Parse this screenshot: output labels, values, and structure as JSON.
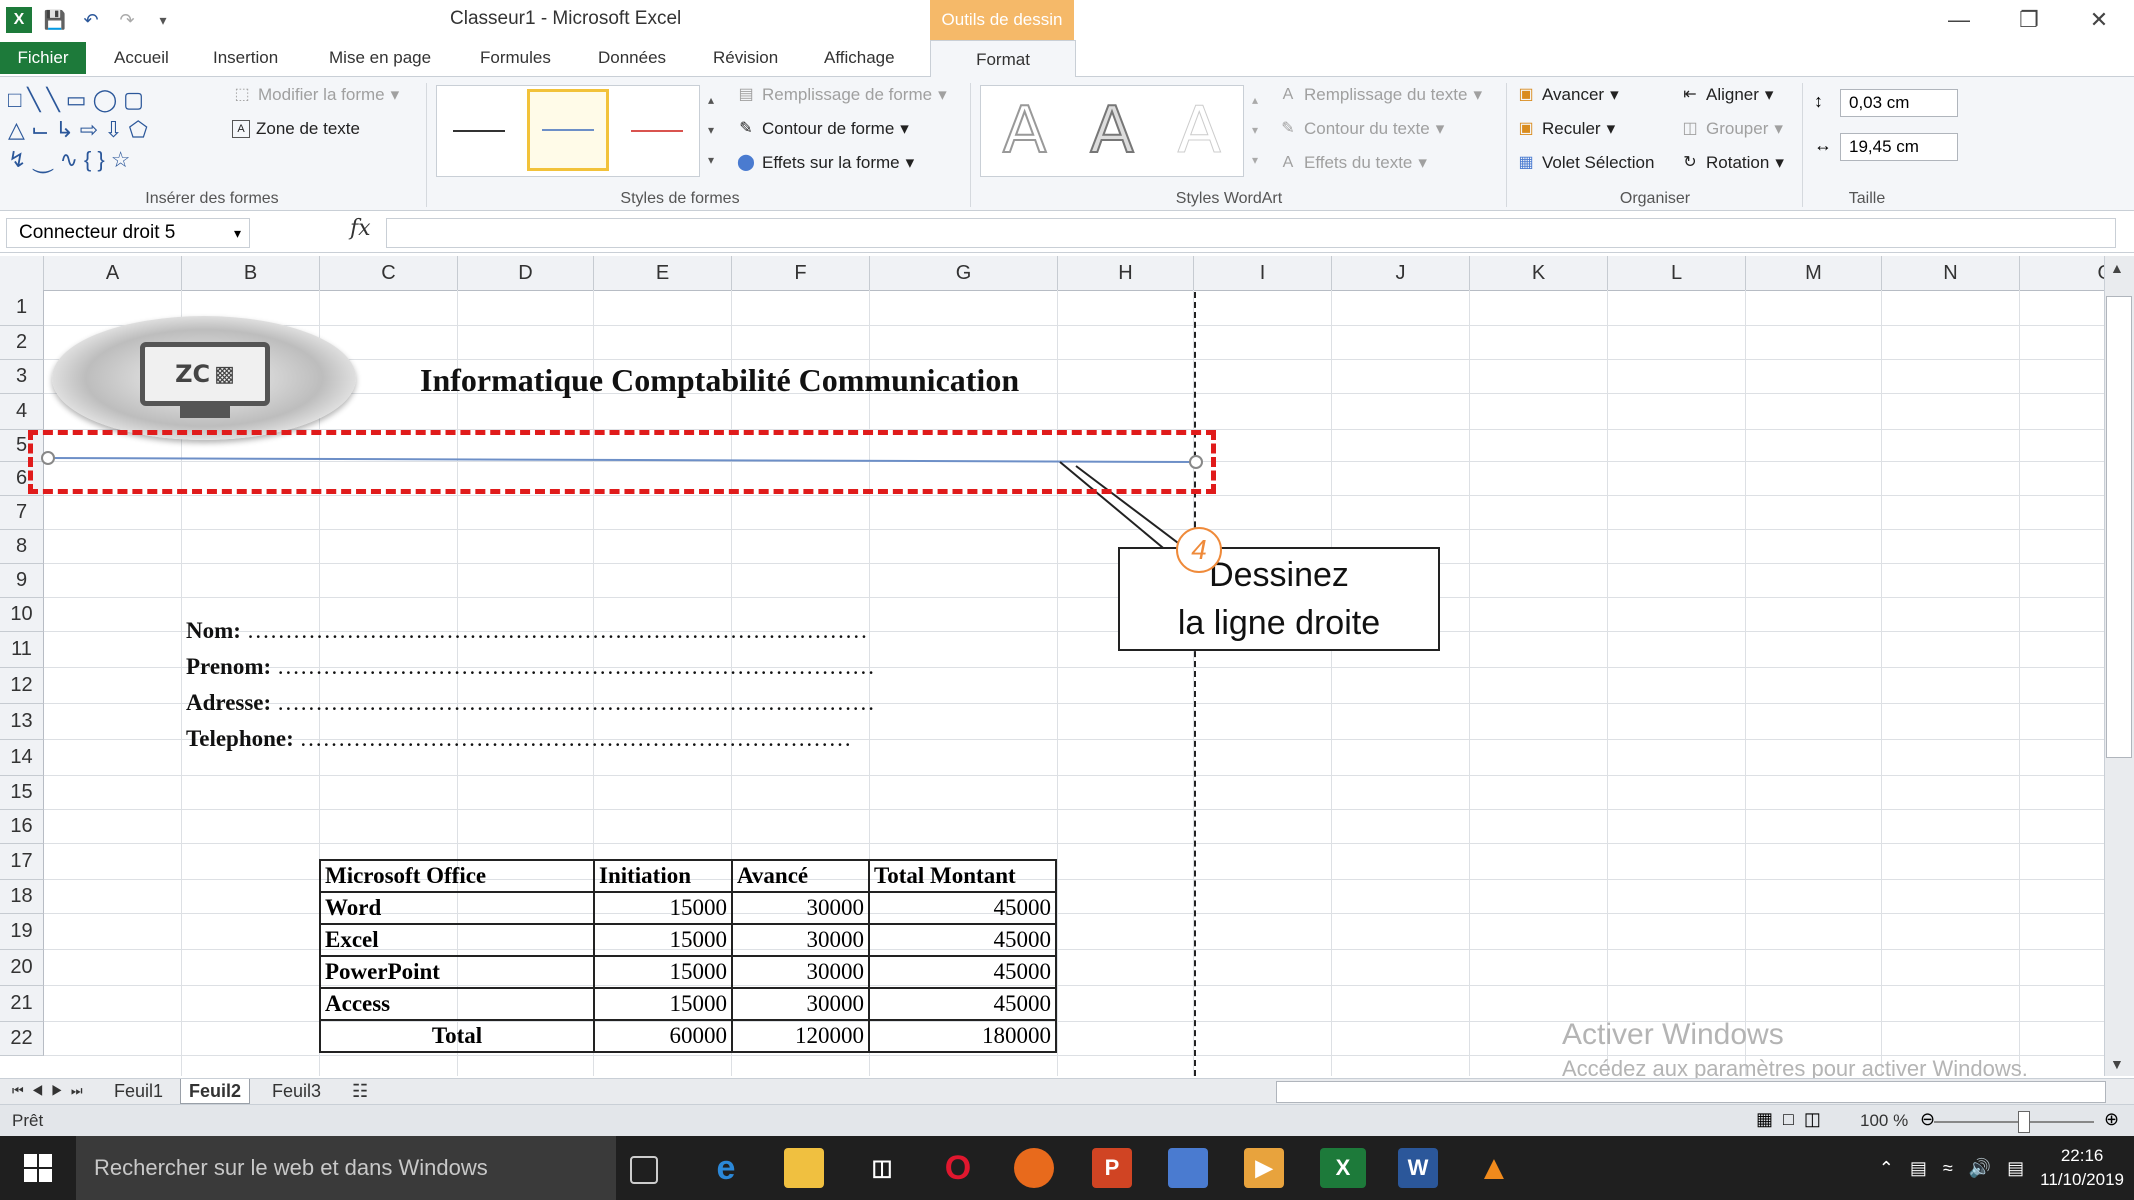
{
  "window": {
    "title": "Classeur1 - Microsoft Excel",
    "context_tab_group": "Outils de dessin"
  },
  "tabs": {
    "file": "Fichier",
    "home": "Accueil",
    "insert": "Insertion",
    "layout": "Mise en page",
    "formulas": "Formules",
    "data": "Données",
    "review": "Révision",
    "view": "Affichage",
    "format": "Format"
  },
  "ribbon": {
    "insert_shapes": {
      "label": "Insérer des formes",
      "edit_shape": "Modifier la forme",
      "text_box": "Zone de texte"
    },
    "shape_styles": {
      "label": "Styles de formes",
      "fill": "Remplissage de forme",
      "outline": "Contour de forme",
      "effects": "Effets sur la forme"
    },
    "wordart": {
      "label": "Styles WordArt",
      "text_fill": "Remplissage du texte",
      "text_outline": "Contour du texte",
      "text_effects": "Effets du texte",
      "sample": "A"
    },
    "arrange": {
      "label": "Organiser",
      "bring_forward": "Avancer",
      "send_backward": "Reculer",
      "selection_pane": "Volet Sélection",
      "align": "Aligner",
      "group": "Grouper",
      "rotate": "Rotation"
    },
    "size": {
      "label": "Taille",
      "height": "0,03 cm",
      "width": "19,45 cm"
    }
  },
  "formula_bar": {
    "name_box": "Connecteur droit 5",
    "fx": "fx",
    "value": ""
  },
  "columns": [
    "A",
    "B",
    "C",
    "D",
    "E",
    "F",
    "G",
    "H",
    "I",
    "J",
    "K",
    "L",
    "M",
    "N",
    "O"
  ],
  "rows": [
    "1",
    "2",
    "3",
    "4",
    "5",
    "6",
    "7",
    "8",
    "9",
    "10",
    "11",
    "12",
    "13",
    "14",
    "15",
    "16",
    "17",
    "18",
    "19",
    "20",
    "21",
    "22"
  ],
  "sheet": {
    "title": "Informatique Comptabilité Communication",
    "logo_text": "ZC",
    "form_fields": [
      {
        "label": "Nom:",
        "dots": "………………………………………………………………………"
      },
      {
        "label": "Prenom:",
        "dots": "……………………………………………………………………"
      },
      {
        "label": "Adresse:",
        "dots": "……………………………………………………………………"
      },
      {
        "label": "Telephone:",
        "dots": "………………………………………………………………"
      }
    ],
    "table": {
      "headers": [
        "Microsoft Office",
        "Initiation",
        "Avancé",
        "Total Montant"
      ],
      "rows": [
        [
          "Word",
          "15000",
          "30000",
          "45000"
        ],
        [
          "Excel",
          "15000",
          "30000",
          "45000"
        ],
        [
          "PowerPoint",
          "15000",
          "30000",
          "45000"
        ],
        [
          "Access",
          "15000",
          "30000",
          "45000"
        ],
        [
          "Total",
          "60000",
          "120000",
          "180000"
        ]
      ]
    }
  },
  "callout": {
    "step": "4",
    "line1": "Dessinez",
    "line2": "la ligne droite"
  },
  "watermark": {
    "line1": "Activer Windows",
    "line2": "Accédez aux paramètres pour activer Windows."
  },
  "sheet_tabs": [
    "Feuil1",
    "Feuil2",
    "Feuil3"
  ],
  "status": {
    "text": "Prêt",
    "zoom": "100 %"
  },
  "taskbar": {
    "search": "Rechercher sur le web et dans Windows",
    "time": "22:16",
    "date": "11/10/2019"
  },
  "colors": {
    "excel_green": "#1d7a3a",
    "context_orange": "#f5b969",
    "callout_red": "#e01b1b"
  }
}
